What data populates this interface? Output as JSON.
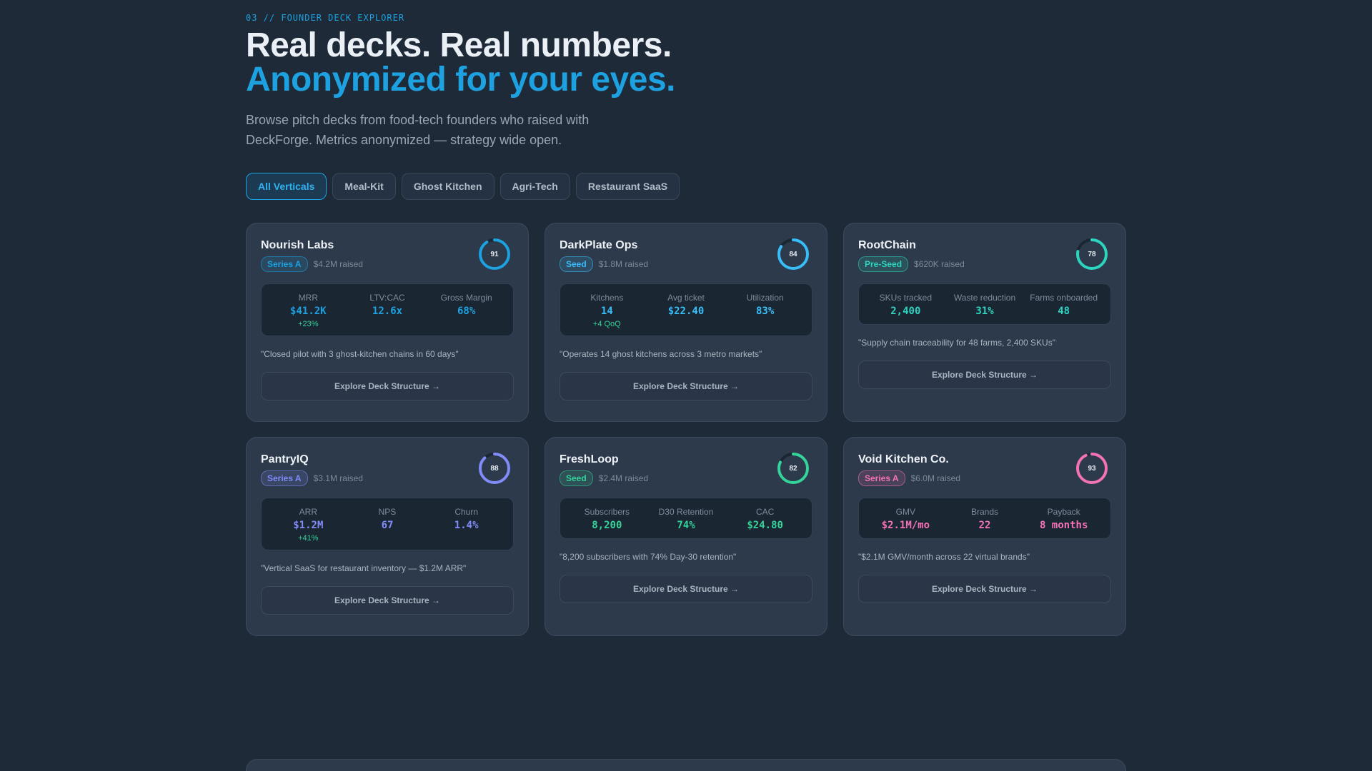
{
  "header": {
    "eyebrow": "03 // FOUNDER DECK EXPLORER",
    "headline_line1": "Real decks. Real numbers.",
    "headline_line2": "Anonymized for your eyes.",
    "subtitle": "Browse pitch decks from food-tech founders who raised with DeckForge. Metrics anonymized — strategy wide open."
  },
  "filters": [
    {
      "label": "All Verticals",
      "active": true
    },
    {
      "label": "Meal-Kit",
      "active": false
    },
    {
      "label": "Ghost Kitchen",
      "active": false
    },
    {
      "label": "Agri-Tech",
      "active": false
    },
    {
      "label": "Restaurant SaaS",
      "active": false
    }
  ],
  "cards": [
    {
      "name": "Nourish Labs",
      "stage": "Series A",
      "raised": "$4.2M raised",
      "score": "91",
      "score_fraction": 0.91,
      "accent": "#1da1e0",
      "metrics": [
        {
          "label": "MRR",
          "value": "$41.2K",
          "delta": "+23%"
        },
        {
          "label": "LTV:CAC",
          "value": "12.6x",
          "delta": ""
        },
        {
          "label": "Gross Margin",
          "value": "68%",
          "delta": ""
        }
      ],
      "quote": "\"Closed pilot with 3 ghost-kitchen chains in 60 days\"",
      "cta": "Explore Deck Structure →"
    },
    {
      "name": "DarkPlate Ops",
      "stage": "Seed",
      "raised": "$1.8M raised",
      "score": "84",
      "score_fraction": 0.84,
      "accent": "#38bdf8",
      "metrics": [
        {
          "label": "Kitchens",
          "value": "14",
          "delta": "+4 QoQ"
        },
        {
          "label": "Avg ticket",
          "value": "$22.40",
          "delta": ""
        },
        {
          "label": "Utilization",
          "value": "83%",
          "delta": ""
        }
      ],
      "quote": "\"Operates 14 ghost kitchens across 3 metro markets\"",
      "cta": "Explore Deck Structure →"
    },
    {
      "name": "RootChain",
      "stage": "Pre-Seed",
      "raised": "$620K raised",
      "score": "78",
      "score_fraction": 0.78,
      "accent": "#2dd4bf",
      "metrics": [
        {
          "label": "SKUs tracked",
          "value": "2,400",
          "delta": ""
        },
        {
          "label": "Waste reduction",
          "value": "31%",
          "delta": ""
        },
        {
          "label": "Farms onboarded",
          "value": "48",
          "delta": ""
        }
      ],
      "quote": "\"Supply chain traceability for 48 farms, 2,400 SKUs\"",
      "cta": "Explore Deck Structure →"
    },
    {
      "name": "PantryIQ",
      "stage": "Series A",
      "raised": "$3.1M raised",
      "score": "88",
      "score_fraction": 0.88,
      "accent": "#818cf8",
      "metrics": [
        {
          "label": "ARR",
          "value": "$1.2M",
          "delta": "+41%"
        },
        {
          "label": "NPS",
          "value": "67",
          "delta": ""
        },
        {
          "label": "Churn",
          "value": "1.4%",
          "delta": ""
        }
      ],
      "quote": "\"Vertical SaaS for restaurant inventory — $1.2M ARR\"",
      "cta": "Explore Deck Structure →"
    },
    {
      "name": "FreshLoop",
      "stage": "Seed",
      "raised": "$2.4M raised",
      "score": "82",
      "score_fraction": 0.82,
      "accent": "#34d399",
      "metrics": [
        {
          "label": "Subscribers",
          "value": "8,200",
          "delta": ""
        },
        {
          "label": "D30 Retention",
          "value": "74%",
          "delta": ""
        },
        {
          "label": "CAC",
          "value": "$24.80",
          "delta": ""
        }
      ],
      "quote": "\"8,200 subscribers with 74% Day-30 retention\"",
      "cta": "Explore Deck Structure →"
    },
    {
      "name": "Void Kitchen Co.",
      "stage": "Series A",
      "raised": "$6.0M raised",
      "score": "93",
      "score_fraction": 0.93,
      "accent": "#f472b6",
      "metrics": [
        {
          "label": "GMV",
          "value": "$2.1M/mo",
          "delta": ""
        },
        {
          "label": "Brands",
          "value": "22",
          "delta": ""
        },
        {
          "label": "Payback",
          "value": "8 months",
          "delta": ""
        }
      ],
      "quote": "\"$2.1M GMV/month across 22 virtual brands\"",
      "cta": "Explore Deck Structure →"
    }
  ]
}
